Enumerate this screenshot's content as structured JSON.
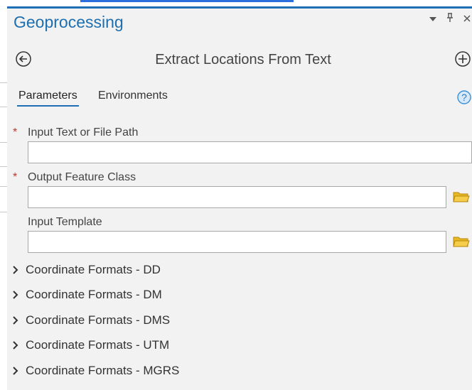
{
  "pane": {
    "title": "Geoprocessing",
    "controls": {
      "dropdown_icon": "caret-down-icon",
      "pin_icon": "pin-icon",
      "close_icon": "close-icon"
    }
  },
  "tool": {
    "title": "Extract Locations From Text",
    "back_icon": "back-arrow-icon",
    "add_icon": "add-icon"
  },
  "tabs": [
    {
      "label": "Parameters",
      "active": true
    },
    {
      "label": "Environments",
      "active": false
    }
  ],
  "help_icon": "help-icon",
  "parameters": [
    {
      "label": "Input Text or File Path",
      "required": true,
      "value": "",
      "has_browse": false
    },
    {
      "label": "Output Feature Class",
      "required": true,
      "value": "",
      "has_browse": true
    },
    {
      "label": "Input Template",
      "required": false,
      "value": "",
      "has_browse": true
    }
  ],
  "required_marker": "*",
  "groups": [
    {
      "label": "Coordinate Formats - DD"
    },
    {
      "label": "Coordinate Formats - DM"
    },
    {
      "label": "Coordinate Formats - DMS"
    },
    {
      "label": "Coordinate Formats - UTM"
    },
    {
      "label": "Coordinate Formats - MGRS"
    }
  ],
  "colors": {
    "accent": "#1f6fb5",
    "title_blue": "#1e6fb0",
    "required_red": "#c0392b",
    "folder_yellow": "#e8b923",
    "background": "#f2f2f2"
  }
}
